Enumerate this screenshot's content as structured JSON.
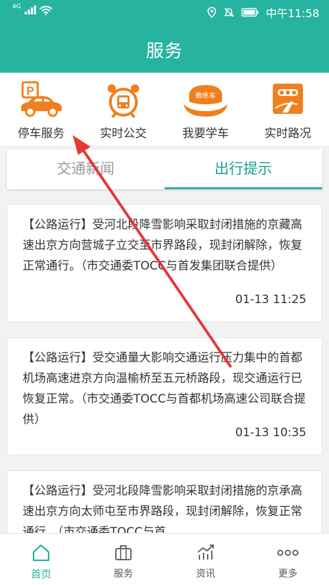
{
  "status_bar": {
    "network": "4G",
    "time": "中午11:58"
  },
  "header": {
    "title": "服务"
  },
  "services": [
    {
      "label": "停车服务",
      "icon": "parking-car-icon"
    },
    {
      "label": "实时公交",
      "icon": "bus-clock-icon"
    },
    {
      "label": "我要学车",
      "icon": "driving-school-icon",
      "badge": "教练车"
    },
    {
      "label": "实时路况",
      "icon": "traffic-road-icon"
    }
  ],
  "tabs": [
    {
      "label": "交通新闻",
      "active": false
    },
    {
      "label": "出行提示",
      "active": true
    }
  ],
  "news": [
    {
      "text": "【公路运行】受河北段降雪影响采取封闭措施的京藏高速出京方向营城子立交至市界路段，现封闭解除，恢复正常通行。（市交通委TOCC与首发集团联合提供）",
      "time": "01-13 11:25"
    },
    {
      "text": "【公路运行】受交通量大影响交通运行压力集中的首都机场高速进京方向温榆桥至五元桥路段，现交通运行已恢复正常。（市交通委TOCC与首都机场高速公司联合提供）",
      "time": "01-13 10:35"
    },
    {
      "text": "【公路运行】受河北段降雪影响采取封闭措施的京承高速出京方向太师屯至市界路段，现封闭解除，恢复正常通行。（市交通委TOCC与首"
    }
  ],
  "bottom_nav": [
    {
      "label": "首页",
      "icon": "home-icon",
      "active": true
    },
    {
      "label": "服务",
      "icon": "briefcase-icon",
      "active": false
    },
    {
      "label": "资讯",
      "icon": "chart-trend-icon",
      "active": false
    },
    {
      "label": "更多",
      "icon": "more-dots-icon",
      "active": false
    }
  ],
  "colors": {
    "brand": "#26b3a0",
    "icon_orange": "#f07f1e",
    "annotation_arrow": "#e53935"
  }
}
